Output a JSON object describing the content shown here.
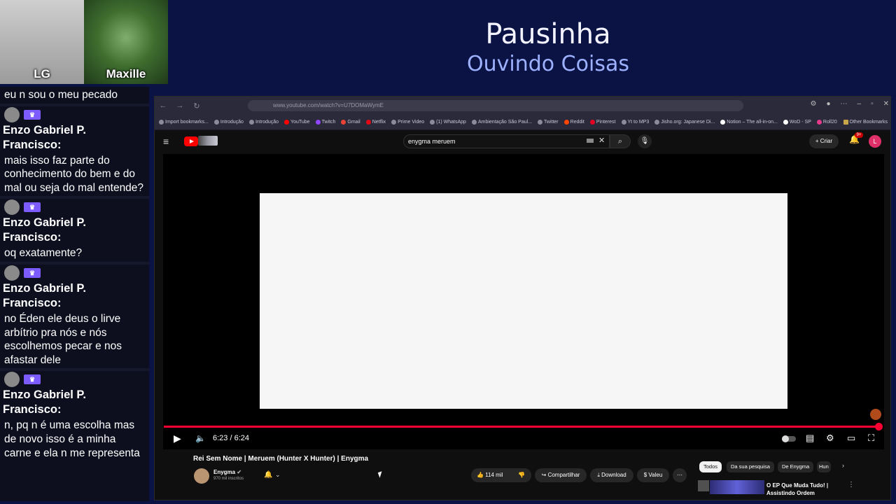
{
  "stream": {
    "title": "Pausinha",
    "subtitle": "Ouvindo Coisas",
    "cams": [
      {
        "name": "LG"
      },
      {
        "name": "Maxille"
      }
    ]
  },
  "chat": {
    "top_partial": "eu n sou o meu pecado",
    "messages": [
      {
        "author_line1": "Enzo Gabriel P.",
        "author_line2": "Francisco:",
        "text": "mais isso faz parte do conhecimento do bem e do mal ou seja do mal entende?"
      },
      {
        "author_line1": "Enzo Gabriel P.",
        "author_line2": "Francisco:",
        "text": "oq exatamente?"
      },
      {
        "author_line1": "Enzo Gabriel P.",
        "author_line2": "Francisco:",
        "text": "no Éden ele deus o lirve arbítrio pra nós e nós escolhemos pecar e nos afastar dele"
      },
      {
        "author_line1": "Enzo Gabriel P.",
        "author_line2": "Francisco:",
        "text": "n, pq n é uma escolha mas de novo isso é a minha carne e ela n me representa"
      }
    ]
  },
  "browser": {
    "url": "www.youtube.com/watch?v=U7DOMaWymE",
    "bookmarks": [
      "Import bookmarks...",
      "Introdução",
      "Introdução",
      "YouTube",
      "Twitch",
      "Gmail",
      "Netflix",
      "Prime Video",
      "(1) WhatsApp",
      "Ambientação São Paul...",
      "Twitter",
      "Reddit",
      "Pinterest",
      "Yt to MP3",
      "Jisho.org: Japanese Di...",
      "Notion – The all-in-on...",
      "WoD - SP",
      "Roll20"
    ],
    "other_bookmarks": "Other Bookmarks"
  },
  "youtube": {
    "search_query": "enygma meruem",
    "create_label": "Criar",
    "notif_count": "9+",
    "account_initial": "L",
    "time": "6:23 / 6:24",
    "progress": 0.997,
    "video_title": "Rei Sem Nome | Meruem (Hunter X Hunter) | Enygma",
    "channel": "Enygma",
    "subscribers": "970 mil inscritos",
    "likes": "114 mil",
    "share_label": "Compartilhar",
    "download_label": "Download",
    "thanks_label": "Valeu",
    "chips": [
      "Todos",
      "Da sua pesquisa",
      "De Enygma",
      "Hun"
    ],
    "rec_title": "O EP Que Muda Tudo! | Assistindo Ordem Paranormal"
  }
}
